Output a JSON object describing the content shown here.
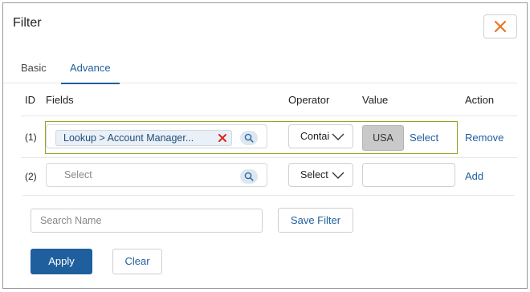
{
  "dialog": {
    "title": "Filter",
    "close_icon": "close-x-icon",
    "accent": "#e87722"
  },
  "tabs": [
    {
      "label": "Basic",
      "active": false
    },
    {
      "label": "Advance",
      "active": true
    }
  ],
  "columns": {
    "id": "ID",
    "fields": "Fields",
    "operator": "Operator",
    "value": "Value",
    "action": "Action"
  },
  "rows": [
    {
      "id": "(1)",
      "field_chip": "Lookup > Account Manager...",
      "operator": "Contains",
      "value": "USA",
      "value_link": "Select",
      "action": "Remove"
    },
    {
      "id": "(2)",
      "field_placeholder": "Select",
      "operator": "Select",
      "value": "",
      "action": "Add"
    }
  ],
  "footer": {
    "search_name_placeholder": "Search Name",
    "save_filter": "Save Filter",
    "apply": "Apply",
    "clear": "Clear"
  },
  "colors": {
    "primary": "#1f5f9e",
    "highlight_border": "#8aab1e",
    "remove_x": "#d9261c"
  }
}
